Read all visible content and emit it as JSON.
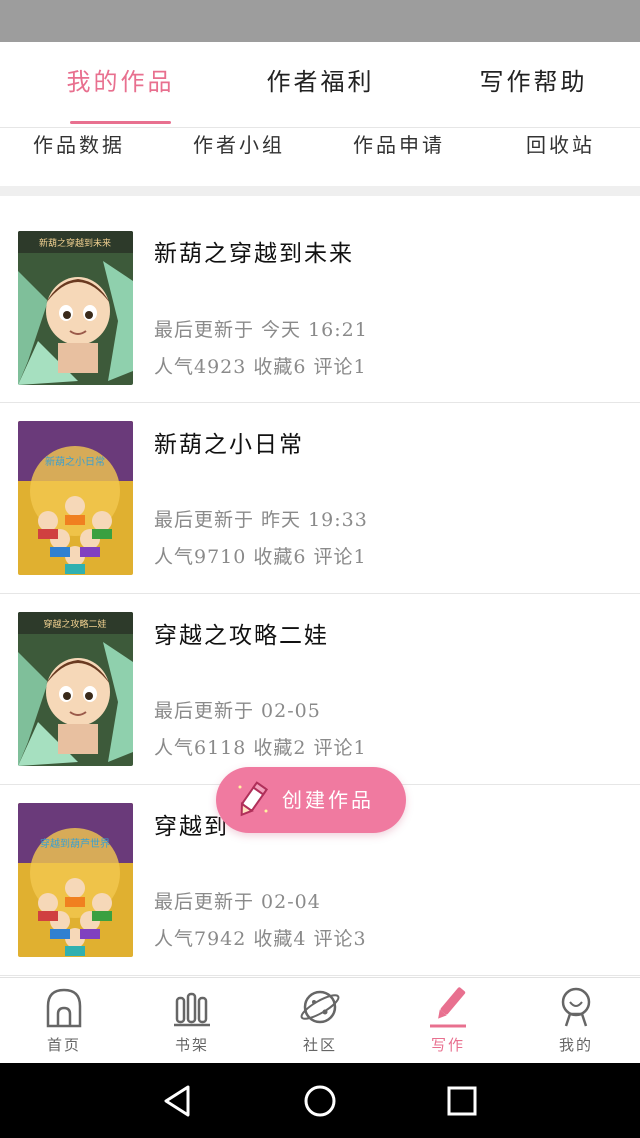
{
  "top_tabs": [
    {
      "label": "我的作品",
      "active": true
    },
    {
      "label": "作者福利",
      "active": false
    },
    {
      "label": "写作帮助",
      "active": false
    }
  ],
  "sub_tabs": [
    {
      "label": "作品数据"
    },
    {
      "label": "作者小组"
    },
    {
      "label": "作品申请"
    },
    {
      "label": "回收站"
    }
  ],
  "works": [
    {
      "title": "新葫之穿越到未来",
      "updated": "最后更新于 今天 16:21",
      "stats": "人气4923 收藏6 评论1",
      "cover_text": "新葫之穿越到未来"
    },
    {
      "title": "新葫之小日常",
      "updated": "最后更新于 昨天 19:33",
      "stats": "人气9710 收藏6 评论1",
      "cover_text": "新葫之小日常"
    },
    {
      "title": "穿越之攻略二娃",
      "updated": "最后更新于 02-05",
      "stats": "人气6118 收藏2 评论1",
      "cover_text": "穿越之攻略二娃"
    },
    {
      "title": "穿越到",
      "updated": "最后更新于 02-04",
      "stats": "人气7942 收藏4 评论3",
      "cover_text": "穿越到葫芦世界"
    }
  ],
  "fab": {
    "label": "创建作品",
    "icon": "pencil-icon"
  },
  "bottom_nav": [
    {
      "label": "首页",
      "icon": "home-icon",
      "active": false
    },
    {
      "label": "书架",
      "icon": "bookshelf-icon",
      "active": false
    },
    {
      "label": "社区",
      "icon": "planet-icon",
      "active": false
    },
    {
      "label": "写作",
      "icon": "pen-icon",
      "active": true
    },
    {
      "label": "我的",
      "icon": "profile-icon",
      "active": false
    }
  ],
  "colors": {
    "accent": "#e8708f",
    "fab": "#f07aa0",
    "status_bar": "#9d9d9d",
    "system_bar": "#000000"
  }
}
